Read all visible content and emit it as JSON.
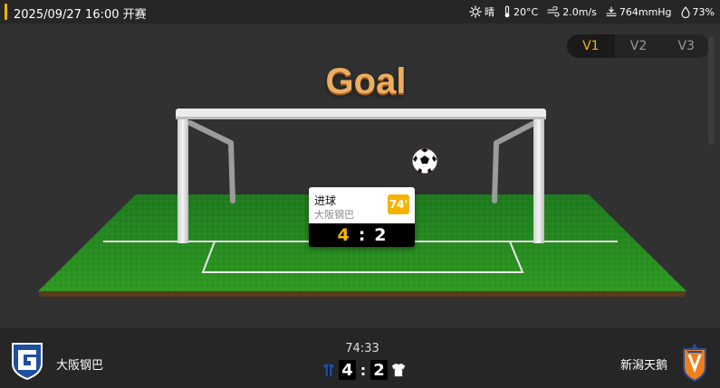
{
  "header": {
    "datetime": "2025/09/27 16:00 开赛",
    "accent_color": "#f5b301",
    "weather": {
      "condition_icon": "sun-icon",
      "condition": "晴",
      "temperature_icon": "thermometer-icon",
      "temperature": "20°C",
      "wind_icon": "wind-icon",
      "wind": "2.0m/s",
      "pressure_icon": "pressure-icon",
      "pressure": "764mmHg",
      "humidity_icon": "humidity-icon",
      "humidity": "73%"
    }
  },
  "versions": {
    "tabs": [
      "V1",
      "V2",
      "V3"
    ],
    "selected": "V1"
  },
  "animation": {
    "title": "Goal",
    "event_card": {
      "type": "进球",
      "team": "大阪钢巴",
      "minute": "74'",
      "home_score": "4",
      "separator": ":",
      "away_score": "2"
    }
  },
  "match": {
    "home_team": "大阪钢巴",
    "home_logo_icon": "gamba-osaka-crest-icon",
    "away_team": "新潟天鹅",
    "away_logo_icon": "albirex-niigata-crest-icon",
    "clock": "74:33",
    "home_score": "4",
    "separator": ":",
    "away_score": "2",
    "home_kit_color": "#1f4fa0",
    "away_kit_color": "#ffffff"
  }
}
